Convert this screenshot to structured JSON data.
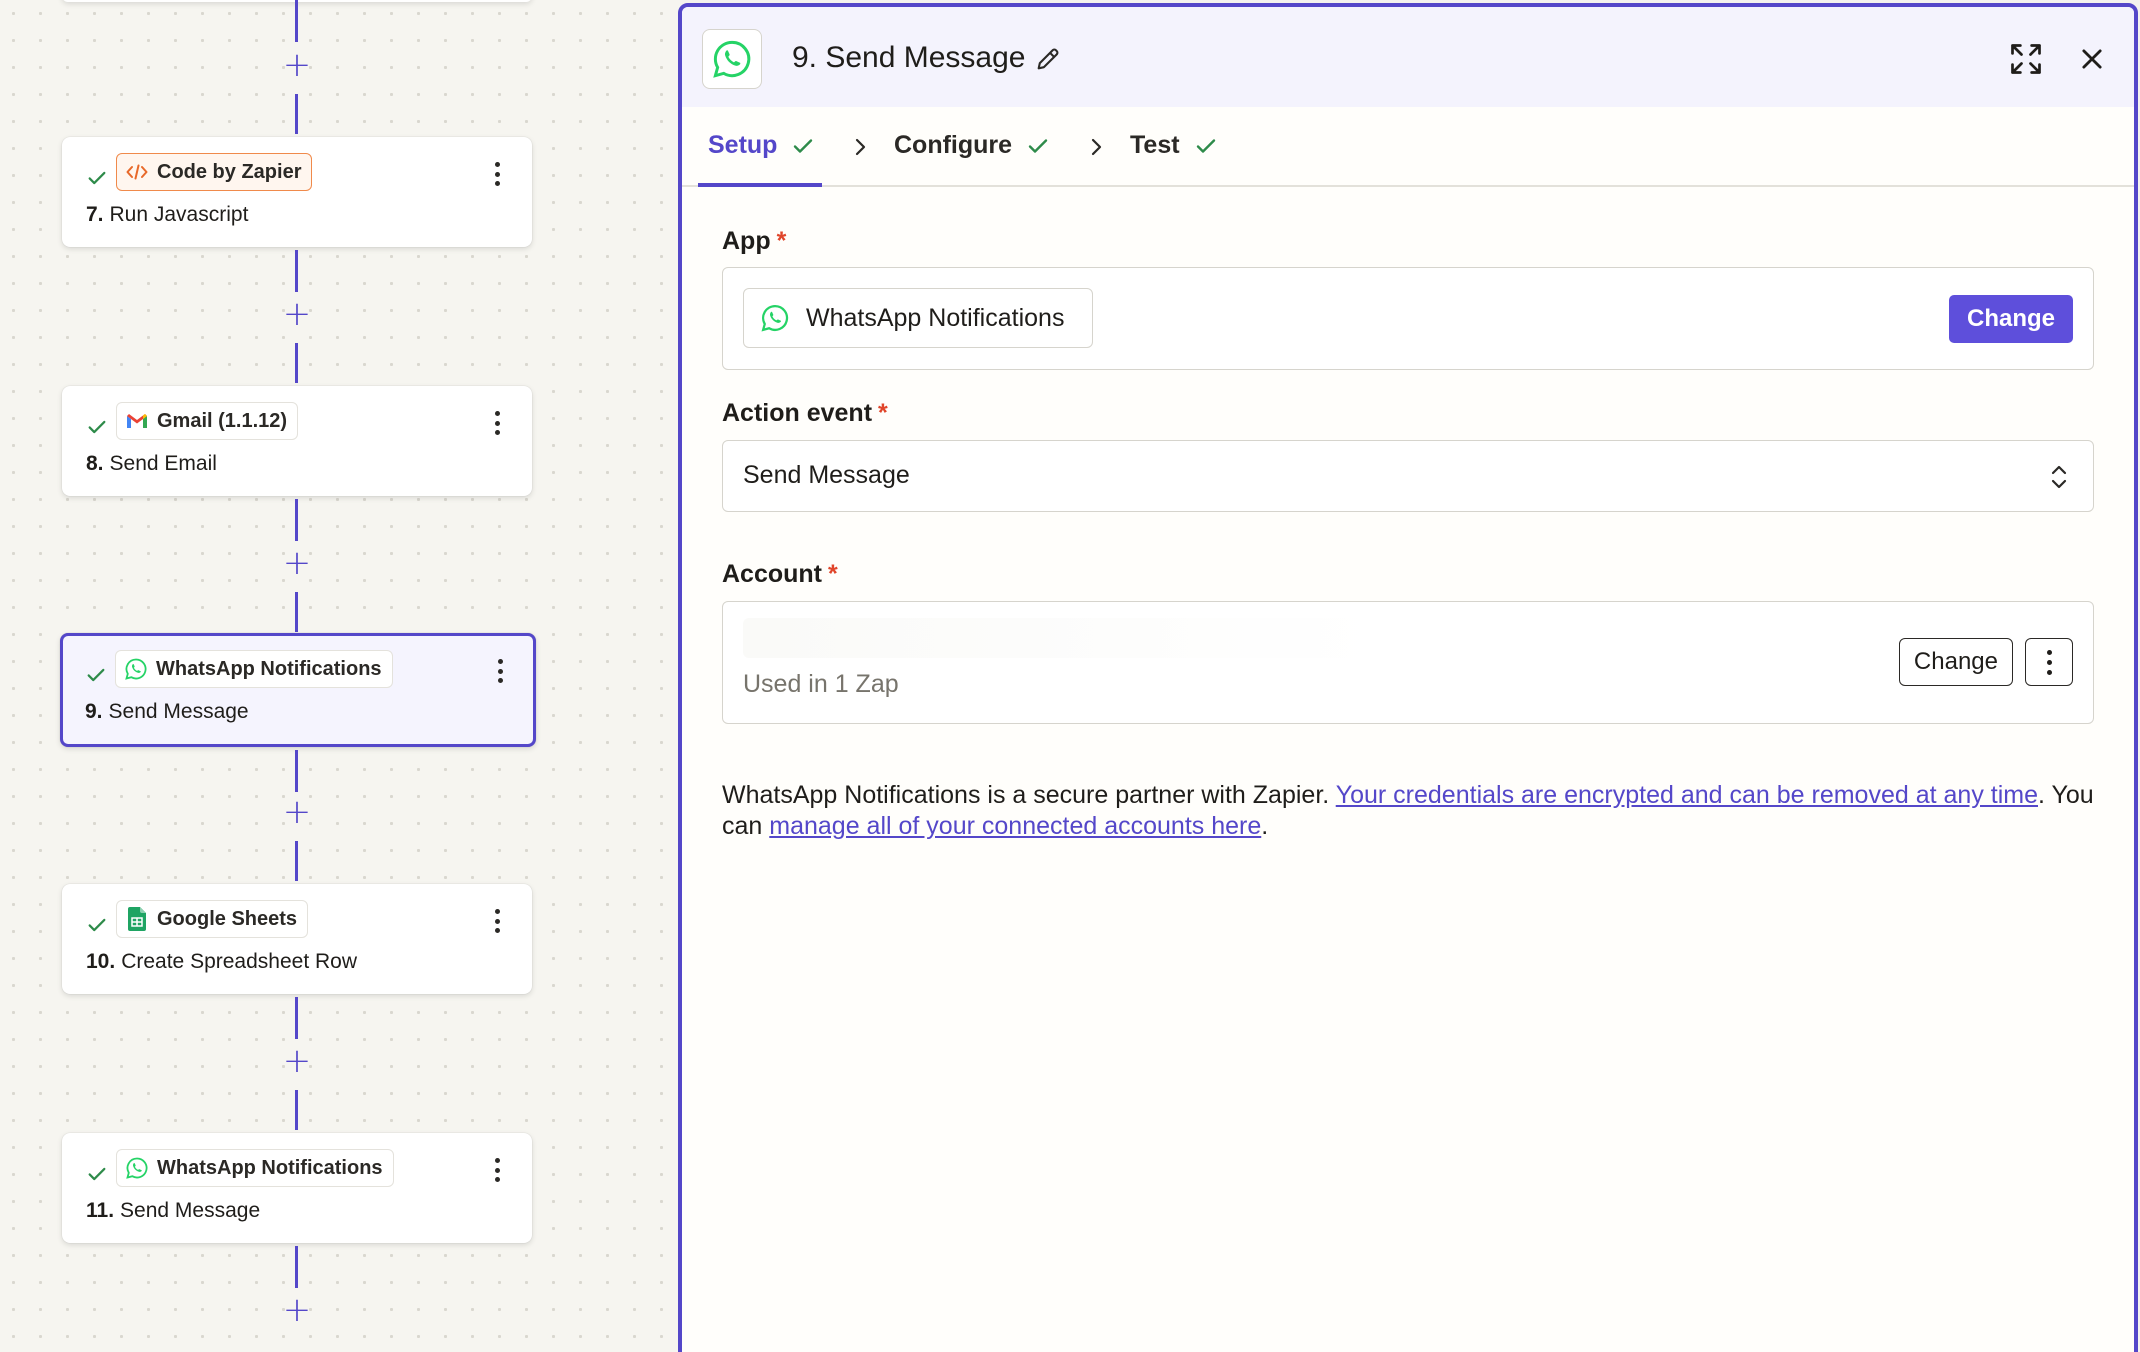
{
  "canvas": {
    "steps": [
      {
        "app": "Code by Zapier",
        "number": "7.",
        "title": "Run Javascript",
        "icon": "code-icon"
      },
      {
        "app": "Gmail (1.1.12)",
        "number": "8.",
        "title": "Send Email",
        "icon": "gmail-icon"
      },
      {
        "app": "WhatsApp Notifications",
        "number": "9.",
        "title": "Send Message",
        "icon": "whatsapp-icon",
        "selected": true
      },
      {
        "app": "Google Sheets",
        "number": "10.",
        "title": "Create Spreadsheet Row",
        "icon": "google-sheets-icon"
      },
      {
        "app": "WhatsApp Notifications",
        "number": "11.",
        "title": "Send Message",
        "icon": "whatsapp-icon"
      }
    ],
    "add_step_symbol": "+"
  },
  "panel": {
    "title": "9. Send Message",
    "tabs": [
      {
        "label": "Setup",
        "active": true
      },
      {
        "label": "Configure"
      },
      {
        "label": "Test"
      }
    ],
    "app_field": {
      "label": "App",
      "required_mark": "*",
      "value": "WhatsApp Notifications",
      "change_label": "Change"
    },
    "action_event_field": {
      "label": "Action event",
      "required_mark": "*",
      "value": "Send Message"
    },
    "account_field": {
      "label": "Account",
      "required_mark": "*",
      "subtext": "Used in 1 Zap",
      "change_label": "Change"
    },
    "info": {
      "prefix": "WhatsApp Notifications is a secure partner with Zapier. ",
      "link1": "Your credentials are encrypted and can be removed at any time",
      "middle": ". You can ",
      "link2": "manage all of your connected accounts here",
      "suffix": "."
    }
  },
  "colors": {
    "accent": "#5447c9",
    "primary_button": "#5e4fdb",
    "success_check": "#2e8b4a",
    "required": "#e0452a",
    "whatsapp_green": "#25d366"
  }
}
